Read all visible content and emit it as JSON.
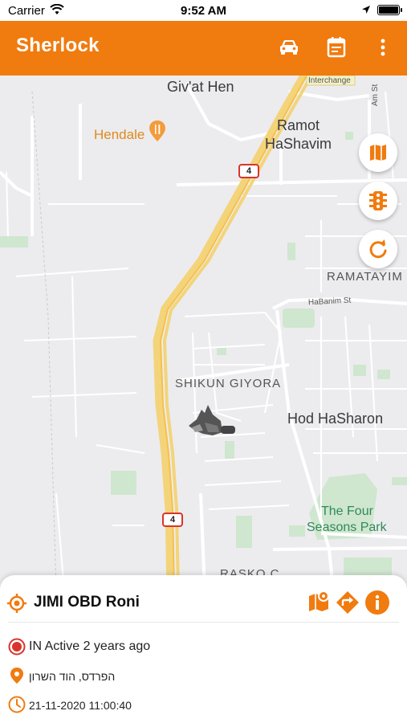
{
  "status_bar": {
    "carrier": "Carrier",
    "time": "9:52 AM"
  },
  "app_bar": {
    "title": "Sherlock",
    "icons": [
      "car-icon",
      "calendar-icon",
      "more-vert-icon"
    ],
    "background": "#f07b0f"
  },
  "map": {
    "labels": {
      "givat_hen": "Giv'at Hen",
      "hendale": "Hendale",
      "ramot_1": "Ramot",
      "ramot_2": "HaShavim",
      "ramatayim": "RAMATAYIM",
      "habanim": "HaBanim St",
      "shikun": "SHIKUN GIYORA",
      "hod": "Hod HaSharon",
      "four_1": "The Four",
      "four_2": "Seasons Park",
      "rasko": "RASKO C",
      "interchange": "Interchange",
      "am_st": "Am St"
    },
    "road_number_top": "4",
    "road_number_bottom": "4",
    "buttons": [
      "map-layers-icon",
      "traffic-light-icon",
      "refresh-icon"
    ]
  },
  "sheet": {
    "device_name": "JIMI OBD Roni",
    "status": "IN Active 2 years ago",
    "address": "הפרדס, הוד השרון",
    "datetime": "21-11-2020 11:00:40",
    "accent": "#f07b0f",
    "status_color": "#d9342b"
  }
}
